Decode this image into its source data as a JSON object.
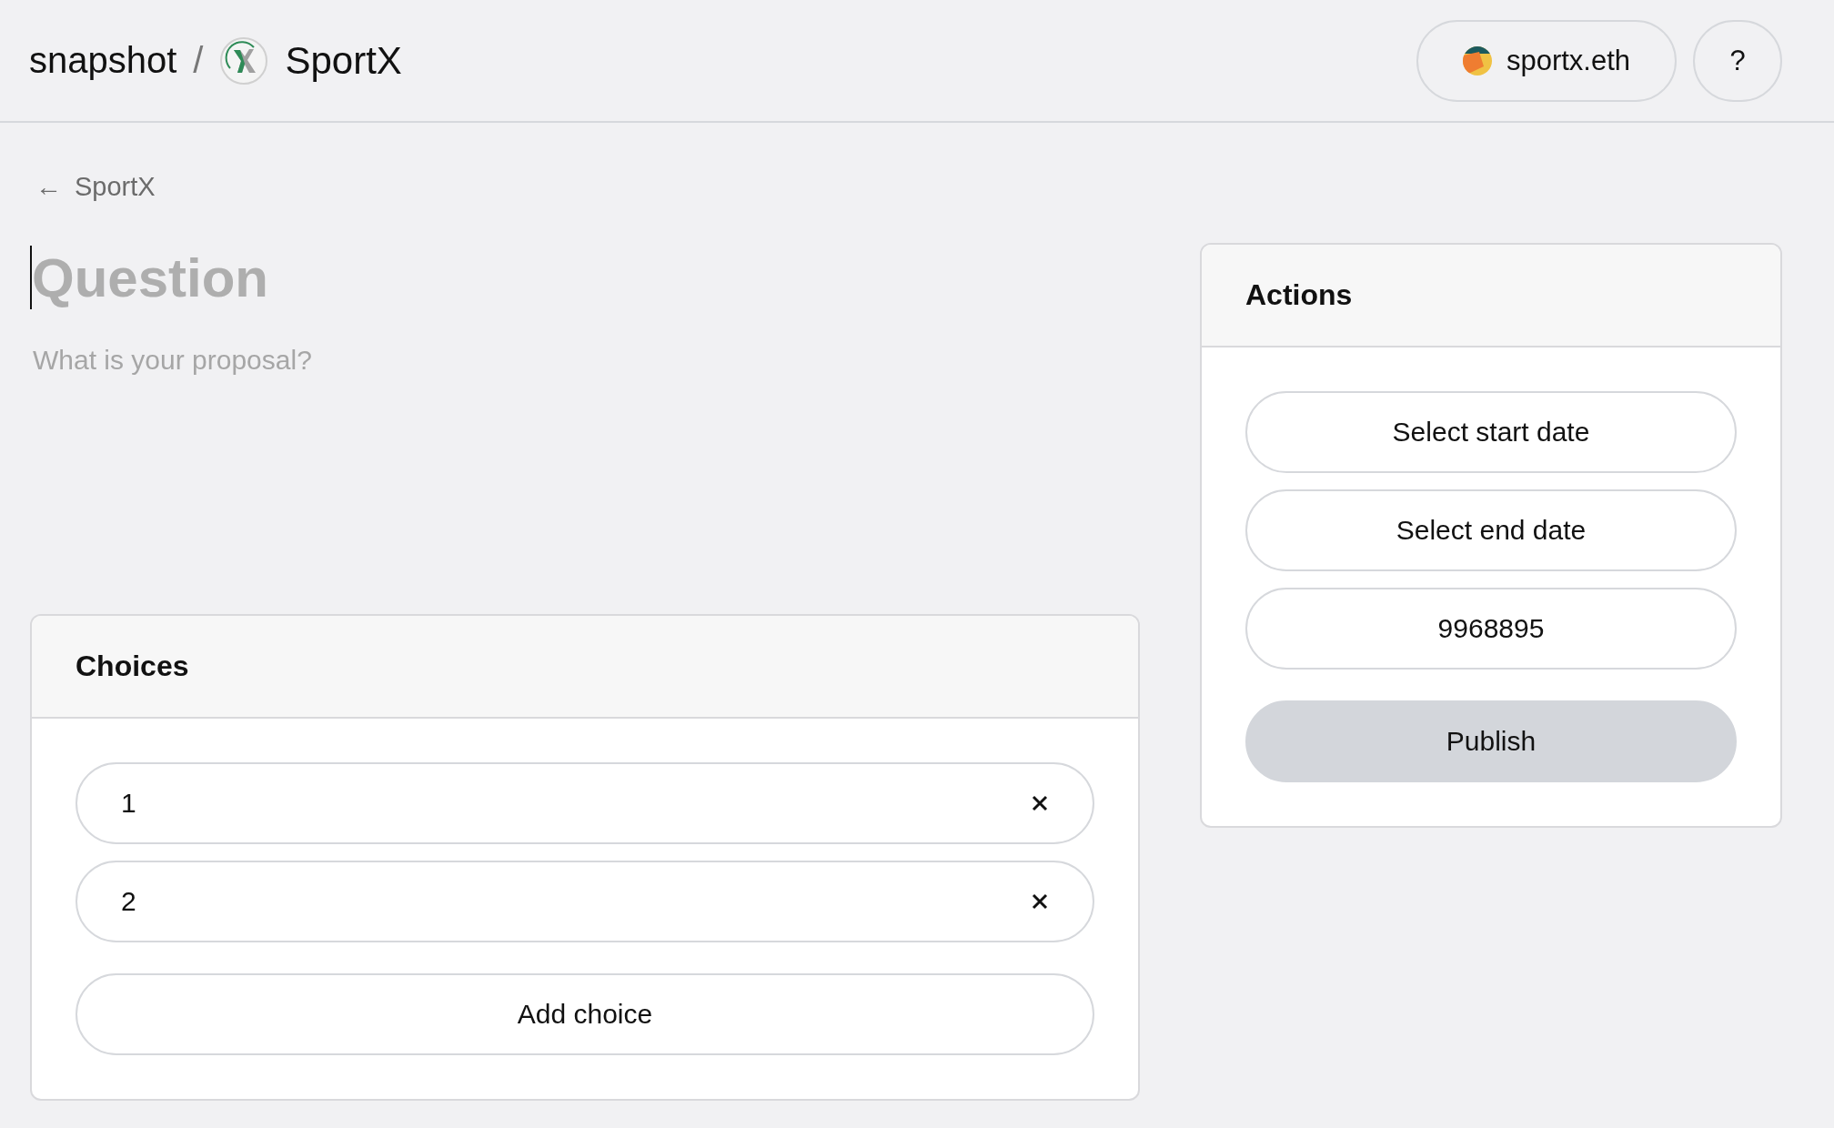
{
  "header": {
    "brand": "snapshot",
    "separator": "/",
    "space_name": "SportX",
    "account": "sportx.eth",
    "help": "?"
  },
  "back_link": {
    "arrow": "←",
    "label": "SportX"
  },
  "title_field": {
    "placeholder": "Question"
  },
  "body_field": {
    "placeholder": "What is your proposal?"
  },
  "choices": {
    "title": "Choices",
    "items": [
      {
        "value": "1"
      },
      {
        "value": "2"
      }
    ],
    "add_button": "Add choice"
  },
  "actions": {
    "title": "Actions",
    "buttons": [
      {
        "label": "Select start date",
        "kind": "outline"
      },
      {
        "label": "Select end date",
        "kind": "outline"
      },
      {
        "label": "9968895",
        "kind": "outline"
      },
      {
        "label": "Publish",
        "kind": "filled"
      }
    ]
  }
}
